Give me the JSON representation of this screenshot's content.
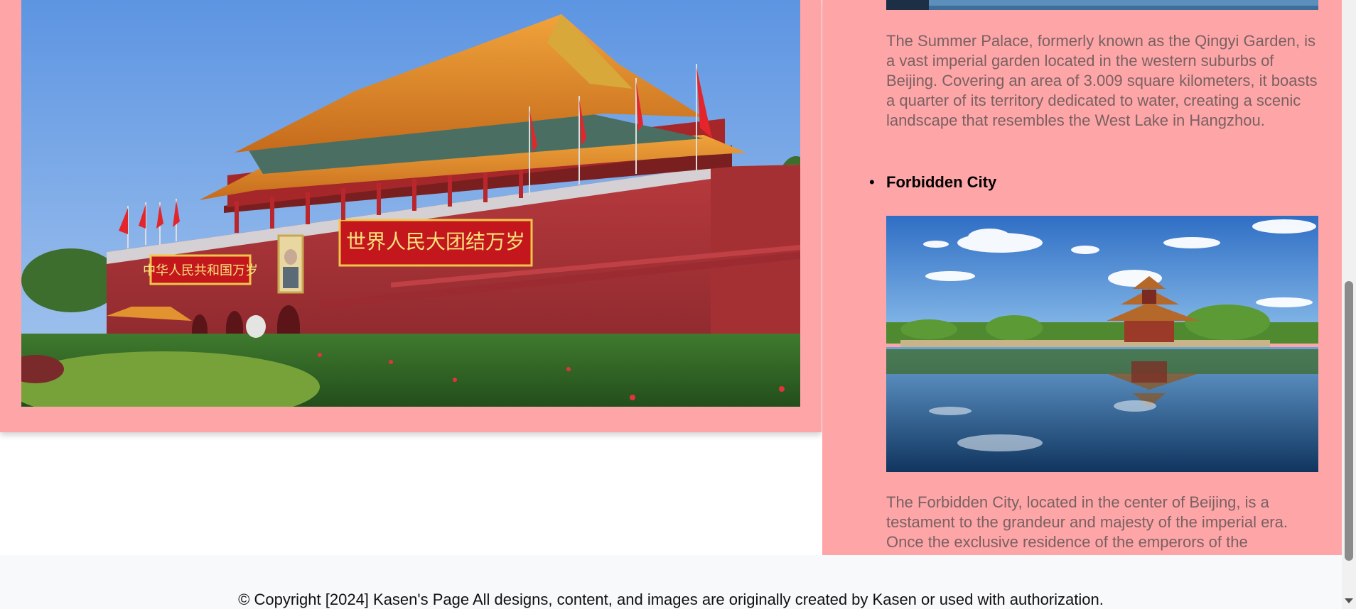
{
  "left": {
    "image_label": "Tiananmen Gate photo",
    "banner_left": "中华人民共和国万岁",
    "banner_right": "世界人民大团结万岁"
  },
  "right": {
    "summer_palace_description": "The Summer Palace, formerly known as the Qingyi Garden, is a vast imperial garden located in the western suburbs of Beijing. Covering an area of 3.009 square kilometers, it boasts a quarter of its territory dedicated to water, creating a scenic landscape that resembles the West Lake in Hangzhou.",
    "forbidden_city_heading": "Forbidden City",
    "forbidden_city_description": "The Forbidden City, located in the center of Beijing, is a testament to the grandeur and majesty of the imperial era. Once the exclusive residence of the emperors of the"
  },
  "footer": {
    "copyright": "© Copyright [2024] Kasen's Page All designs, content, and images are originally created by Kasen or used with authorization."
  },
  "colors": {
    "panel_bg": "#fea5a8",
    "body_text": "#7a6161",
    "footer_bg": "#f8f9fa"
  }
}
